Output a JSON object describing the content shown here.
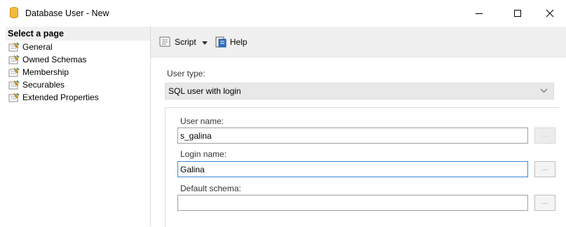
{
  "window": {
    "title": "Database User - New",
    "buttons": [
      "minimize-icon",
      "maximize-icon",
      "close-icon"
    ]
  },
  "sidebar": {
    "header": "Select a page",
    "items": [
      {
        "label": "General",
        "selected": true
      },
      {
        "label": "Owned Schemas"
      },
      {
        "label": "Membership"
      },
      {
        "label": "Securables"
      },
      {
        "label": "Extended Properties"
      }
    ]
  },
  "toolbar": {
    "script_label": "Script",
    "help_label": "Help"
  },
  "form": {
    "user_type_label": "User type:",
    "user_type_value": "SQL user with login",
    "user_name_label": "User name:",
    "user_name_value": "s_galina",
    "login_name_label": "Login name:",
    "login_name_value": "Galina",
    "default_schema_label": "Default schema:",
    "default_schema_value": "",
    "browse_label": "..."
  }
}
